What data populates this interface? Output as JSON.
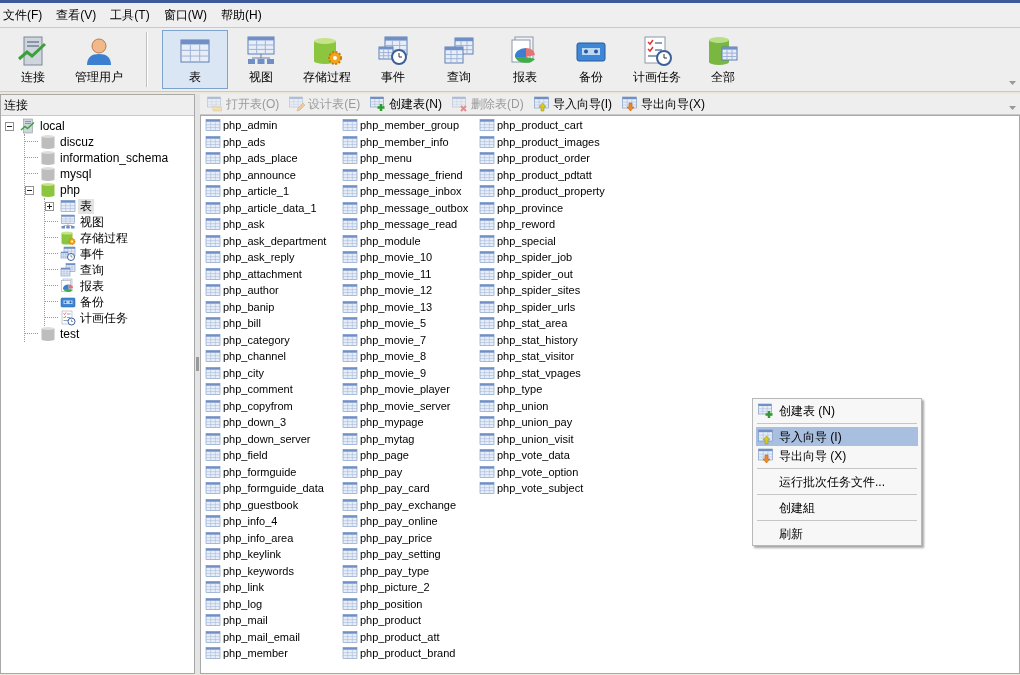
{
  "menu_bar": [
    "文件(F)",
    "查看(V)",
    "工具(T)",
    "窗口(W)",
    "帮助(H)"
  ],
  "toolbar": {
    "groups": [
      [
        {
          "label": "连接",
          "kind": "connection",
          "selected": false
        },
        {
          "label": "管理用户",
          "kind": "user",
          "selected": false
        }
      ],
      [
        {
          "label": "表",
          "kind": "table",
          "selected": true
        },
        {
          "label": "视图",
          "kind": "view",
          "selected": false
        },
        {
          "label": "存储过程",
          "kind": "procedure",
          "selected": false
        },
        {
          "label": "事件",
          "kind": "event",
          "selected": false
        },
        {
          "label": "查询",
          "kind": "query",
          "selected": false
        },
        {
          "label": "报表",
          "kind": "report",
          "selected": false
        },
        {
          "label": "备份",
          "kind": "backup",
          "selected": false
        },
        {
          "label": "计画任务",
          "kind": "schedule",
          "selected": false
        },
        {
          "label": "全部",
          "kind": "all",
          "selected": false
        }
      ]
    ]
  },
  "sidebar": {
    "title": "连接",
    "tree": [
      {
        "label": "local",
        "kind": "connection",
        "selected": false,
        "expanded": true,
        "children": [
          {
            "label": "discuz",
            "kind": "database",
            "open": false,
            "selected": false
          },
          {
            "label": "information_schema",
            "kind": "database",
            "open": false,
            "selected": false
          },
          {
            "label": "mysql",
            "kind": "database",
            "open": false,
            "selected": false
          },
          {
            "label": "php",
            "kind": "database",
            "open": true,
            "selected": false,
            "expanded": true,
            "children": [
              {
                "label": "表",
                "kind": "table",
                "selected": true,
                "expanded": false
              },
              {
                "label": "视图",
                "kind": "view",
                "selected": false
              },
              {
                "label": "存储过程",
                "kind": "procedure",
                "selected": false
              },
              {
                "label": "事件",
                "kind": "event",
                "selected": false
              },
              {
                "label": "查询",
                "kind": "query",
                "selected": false
              },
              {
                "label": "报表",
                "kind": "report",
                "selected": false
              },
              {
                "label": "备份",
                "kind": "backup",
                "selected": false
              },
              {
                "label": "计画任务",
                "kind": "schedule",
                "selected": false
              }
            ]
          },
          {
            "label": "test",
            "kind": "database",
            "open": false,
            "selected": false
          }
        ]
      }
    ]
  },
  "object_toolbar": [
    {
      "label": "打开表(O)",
      "kind": "open_table",
      "disabled": true
    },
    {
      "label": "设计表(E)",
      "kind": "design_table",
      "disabled": true
    },
    {
      "label": "创建表(N)",
      "kind": "create_table",
      "disabled": false
    },
    {
      "label": "删除表(D)",
      "kind": "delete_table",
      "disabled": true
    },
    {
      "label": "导入向导(I)",
      "kind": "import",
      "disabled": false
    },
    {
      "label": "导出向导(X)",
      "kind": "export",
      "disabled": false
    }
  ],
  "tables": [
    "php_admin",
    "php_ads",
    "php_ads_place",
    "php_announce",
    "php_article_1",
    "php_article_data_1",
    "php_ask",
    "php_ask_department",
    "php_ask_reply",
    "php_attachment",
    "php_author",
    "php_banip",
    "php_bill",
    "php_category",
    "php_channel",
    "php_city",
    "php_comment",
    "php_copyfrom",
    "php_down_3",
    "php_down_server",
    "php_field",
    "php_formguide",
    "php_formguide_data",
    "php_guestbook",
    "php_info_4",
    "php_info_area",
    "php_keylink",
    "php_keywords",
    "php_link",
    "php_log",
    "php_mail",
    "php_mail_email",
    "php_member",
    "php_member_group",
    "php_member_info",
    "php_menu",
    "php_message_friend",
    "php_message_inbox",
    "php_message_outbox",
    "php_message_read",
    "php_module",
    "php_movie_10",
    "php_movie_11",
    "php_movie_12",
    "php_movie_13",
    "php_movie_5",
    "php_movie_7",
    "php_movie_8",
    "php_movie_9",
    "php_movie_player",
    "php_movie_server",
    "php_mypage",
    "php_mytag",
    "php_page",
    "php_pay",
    "php_pay_card",
    "php_pay_exchange",
    "php_pay_online",
    "php_pay_price",
    "php_pay_setting",
    "php_pay_type",
    "php_picture_2",
    "php_position",
    "php_product",
    "php_product_att",
    "php_product_brand",
    "php_product_cart",
    "php_product_images",
    "php_product_order",
    "php_product_pdtatt",
    "php_product_property",
    "php_province",
    "php_reword",
    "php_special",
    "php_spider_job",
    "php_spider_out",
    "php_spider_sites",
    "php_spider_urls",
    "php_stat_area",
    "php_stat_history",
    "php_stat_visitor",
    "php_stat_vpages",
    "php_type",
    "php_union",
    "php_union_pay",
    "php_union_visit",
    "php_vote_data",
    "php_vote_option",
    "php_vote_subject"
  ],
  "context_menu": [
    [
      {
        "label": "创建表 (N)",
        "kind": "create_table",
        "selected": false
      }
    ],
    [
      {
        "label": "导入向导 (I)",
        "kind": "import",
        "selected": true
      },
      {
        "label": "导出向导 (X)",
        "kind": "export",
        "selected": false
      }
    ],
    [
      {
        "label": "运行批次任务文件...",
        "selected": false
      }
    ],
    [
      {
        "label": "创建組",
        "selected": false
      }
    ],
    [
      {
        "label": "刷新",
        "selected": false
      }
    ]
  ]
}
